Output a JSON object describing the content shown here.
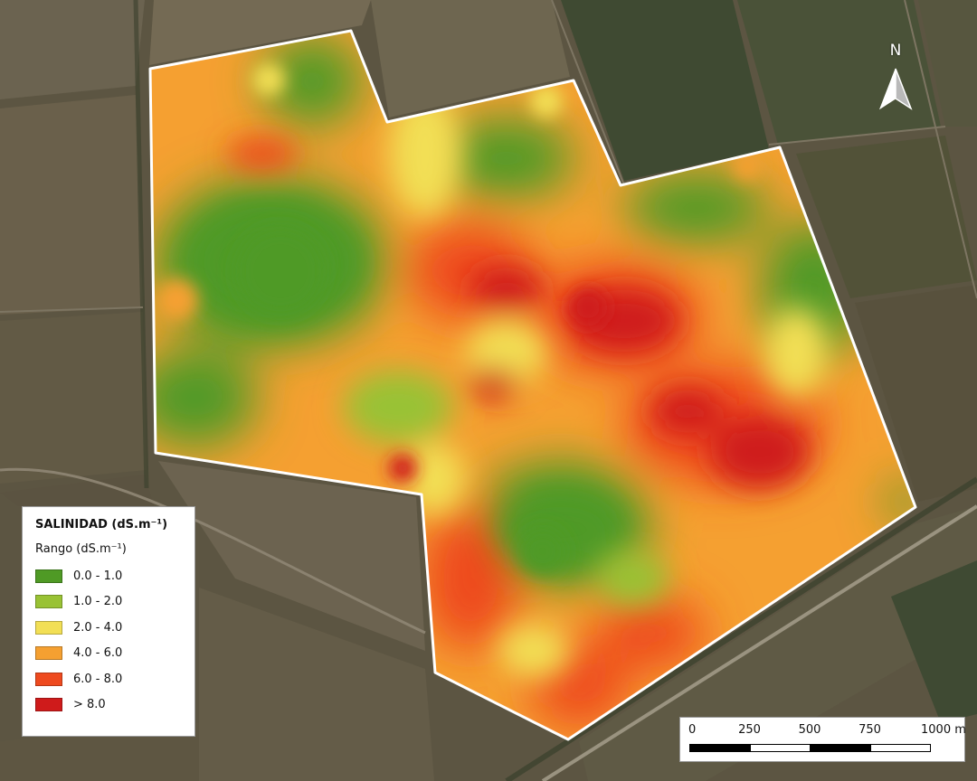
{
  "legend": {
    "title": "SALINIDAD (dS.m⁻¹)",
    "subtitle": "Rango (dS.m⁻¹)",
    "classes": [
      {
        "label": "0.0 - 1.0",
        "color": "#4f9a25"
      },
      {
        "label": "1.0 - 2.0",
        "color": "#99c234"
      },
      {
        "label": "2.0 - 4.0",
        "color": "#f2df55"
      },
      {
        "label": "4.0 - 6.0",
        "color": "#f5a031"
      },
      {
        "label": "6.0 - 8.0",
        "color": "#ee4a1f"
      },
      {
        "label": "> 8.0",
        "color": "#cf1b1b"
      }
    ]
  },
  "scale_bar": {
    "ticks": [
      "0",
      "250",
      "500",
      "750",
      "1000 m"
    ]
  },
  "north_arrow": {
    "label": "N",
    "icon": "north-arrow-icon"
  },
  "map": {
    "basemap": "satellite imagery of agricultural fields",
    "boundary_color": "#ffffff"
  }
}
